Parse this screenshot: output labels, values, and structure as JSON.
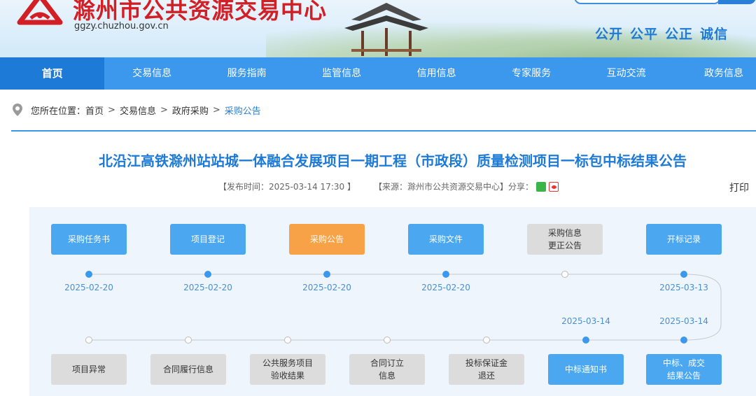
{
  "header": {
    "site_name": "滁州市公共资源交易中心",
    "domain": "ggzy.chuzhou.gov.cn",
    "slogans": [
      "公开",
      "公平",
      "公正",
      "诚信"
    ]
  },
  "nav": {
    "items": [
      {
        "label": "首页",
        "active": true
      },
      {
        "label": "交易信息"
      },
      {
        "label": "服务指南"
      },
      {
        "label": "监管信息"
      },
      {
        "label": "信用信息"
      },
      {
        "label": "专家服务"
      },
      {
        "label": "互动交流"
      },
      {
        "label": "政务信息"
      }
    ]
  },
  "breadcrumb": {
    "prefix": "您所在位置：",
    "items": [
      "首页",
      "交易信息",
      "政府采购",
      "采购公告"
    ],
    "separator": ">"
  },
  "article": {
    "title": "北沿江高铁滁州站站城一体融合发展项目一期工程（市政段）质量检测项目一标包中标结果公告",
    "publish_time": "【发布时间：2025-03-14 17:30 】",
    "source": "【来源：滁州市公共资源交易中心】",
    "share_label": "分享：",
    "print_label": "打印"
  },
  "flow": {
    "top_row": [
      {
        "label": "采购任务书",
        "state": "blue",
        "date": "2025-02-20",
        "done": true
      },
      {
        "label": "项目登记",
        "state": "blue",
        "date": "2025-02-20",
        "done": true
      },
      {
        "label": "采购公告",
        "state": "orange",
        "date": "2025-02-20",
        "done": true
      },
      {
        "label": "采购文件",
        "state": "blue",
        "date": "2025-02-20",
        "done": true
      },
      {
        "label": "采购信息\n更正公告",
        "state": "grey",
        "date": "",
        "done": false
      },
      {
        "label": "开标记录",
        "state": "blue",
        "date": "2025-03-13",
        "done": true
      }
    ],
    "bottom_row": [
      {
        "label": "项目异常",
        "state": "grey",
        "date": "",
        "done": false
      },
      {
        "label": "合同履行信息",
        "state": "grey",
        "date": "",
        "done": false
      },
      {
        "label": "公共服务项目\n验收结果",
        "state": "grey",
        "date": "",
        "done": false
      },
      {
        "label": "合同订立\n信息",
        "state": "grey",
        "date": "",
        "done": false
      },
      {
        "label": "投标保证金\n退还",
        "state": "grey",
        "date": "",
        "done": false
      },
      {
        "label": "中标通知书",
        "state": "blue",
        "date": "2025-03-14",
        "done": true
      },
      {
        "label": "中标、成交\n结果公告",
        "state": "blue",
        "date": "2025-03-14",
        "done": true
      }
    ]
  },
  "colors": {
    "nav": "#3b98ed",
    "nav_active": "#1d7ad6",
    "accent_orange": "#f7a246",
    "brand_red": "#d21e25"
  }
}
